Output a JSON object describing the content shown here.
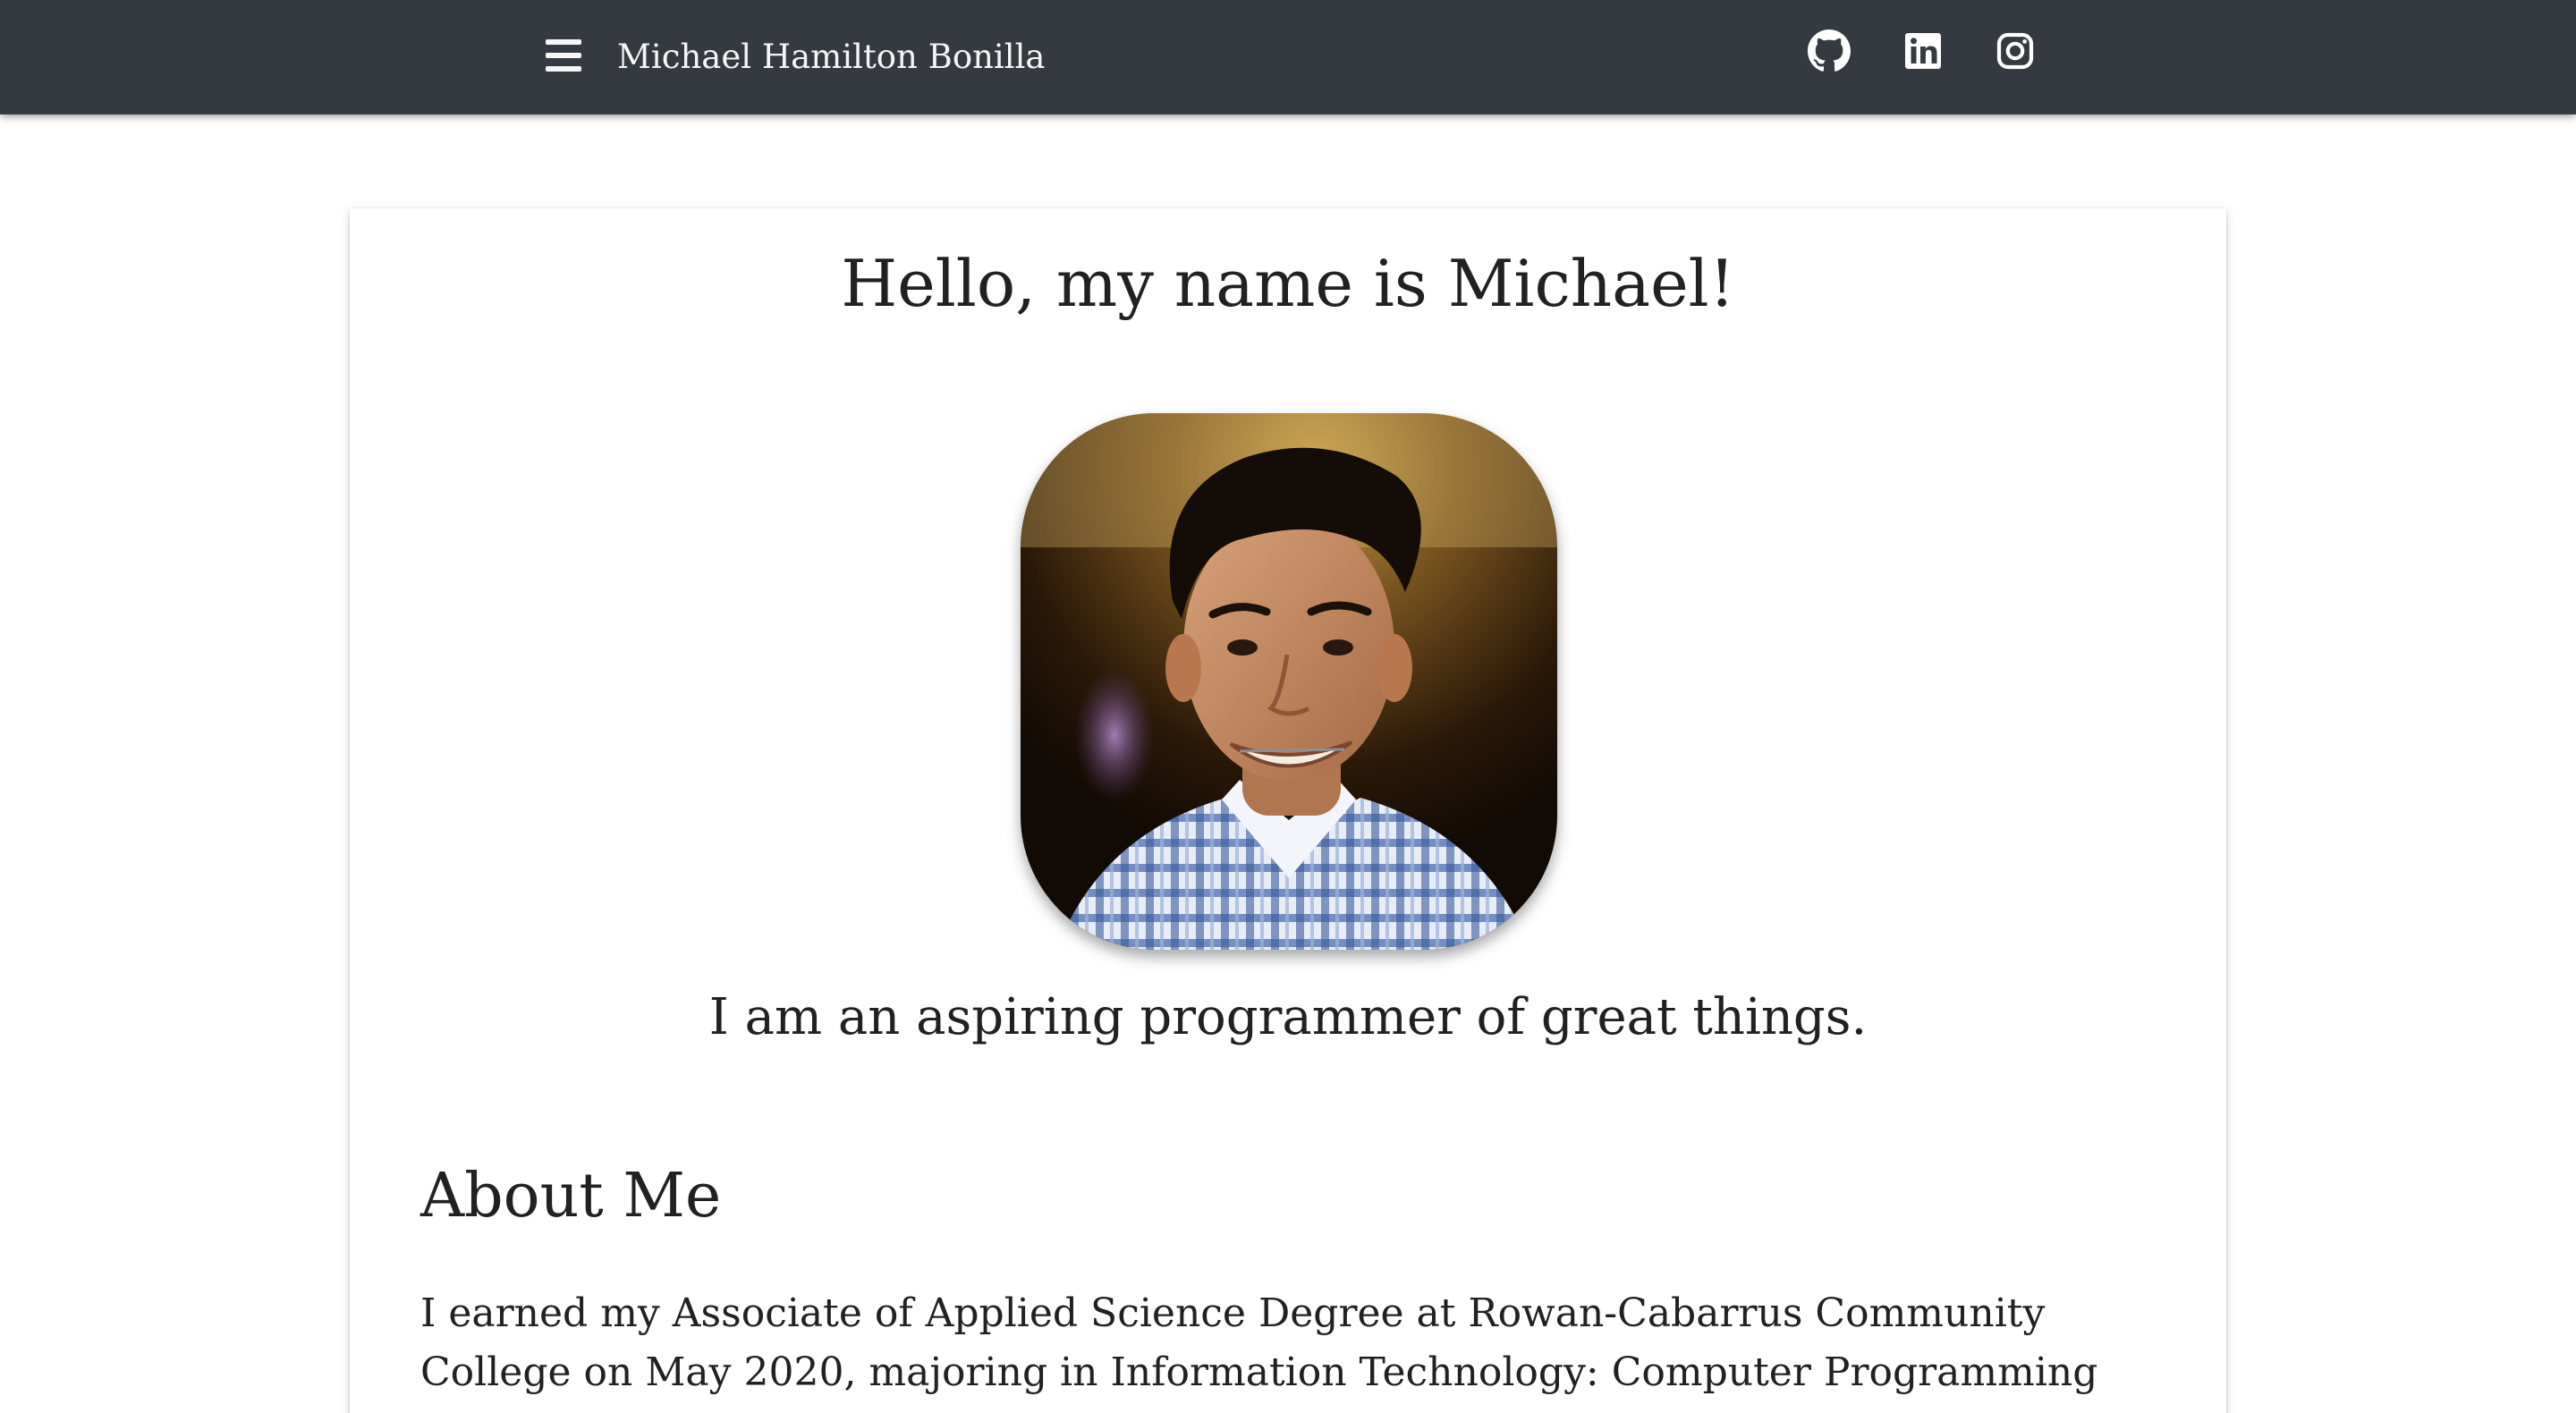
{
  "navbar": {
    "menu_icon": "hamburger-menu-icon",
    "brand": "Michael Hamilton Bonilla",
    "social": [
      {
        "icon": "github-icon",
        "label": "GitHub"
      },
      {
        "icon": "linkedin-icon",
        "label": "LinkedIn"
      },
      {
        "icon": "instagram-icon",
        "label": "Instagram"
      }
    ],
    "background_color": "#343a40",
    "text_color": "#f5f5f5"
  },
  "hero": {
    "greeting": "Hello, my name is Michael!",
    "photo_alt": "Portrait of Michael Hamilton Bonilla",
    "tagline": "I am an aspiring programmer of great things."
  },
  "about": {
    "heading": "About Me",
    "text": "I earned my Associate of Applied Science Degree at Rowan-Cabarrus Community College on May 2020, majoring in Information Technology: Computer Programming and Development (check it"
  }
}
